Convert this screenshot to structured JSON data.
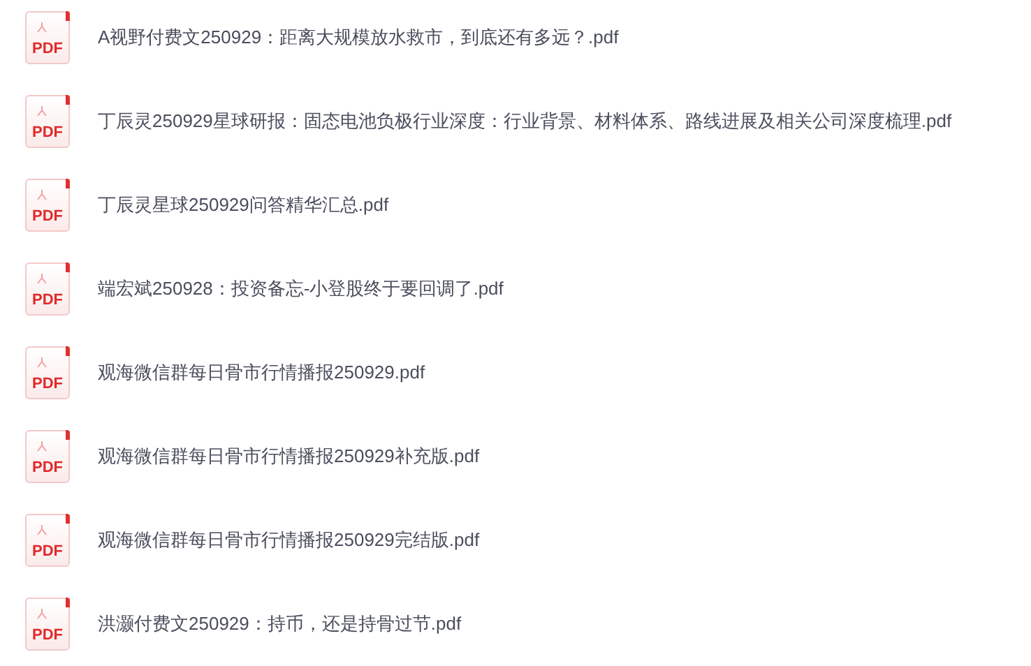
{
  "files": [
    {
      "name": "A视野付费文250929：距离大规模放水救市，到底还有多远？.pdf",
      "badge": "PDF"
    },
    {
      "name": "丁辰灵250929星球研报：固态电池负极行业深度：行业背景、材料体系、路线进展及相关公司深度梳理.pdf",
      "badge": "PDF"
    },
    {
      "name": "丁辰灵星球250929问答精华汇总.pdf",
      "badge": "PDF"
    },
    {
      "name": "端宏斌250928：投资备忘-小登股终于要回调了.pdf",
      "badge": "PDF"
    },
    {
      "name": "观海微信群每日骨市行情播报250929.pdf",
      "badge": "PDF"
    },
    {
      "name": "观海微信群每日骨市行情播报250929补充版.pdf",
      "badge": "PDF"
    },
    {
      "name": "观海微信群每日骨市行情播报250929完结版.pdf",
      "badge": "PDF"
    },
    {
      "name": "洪灏付费文250929：持币，还是持骨过节.pdf",
      "badge": "PDF"
    }
  ]
}
